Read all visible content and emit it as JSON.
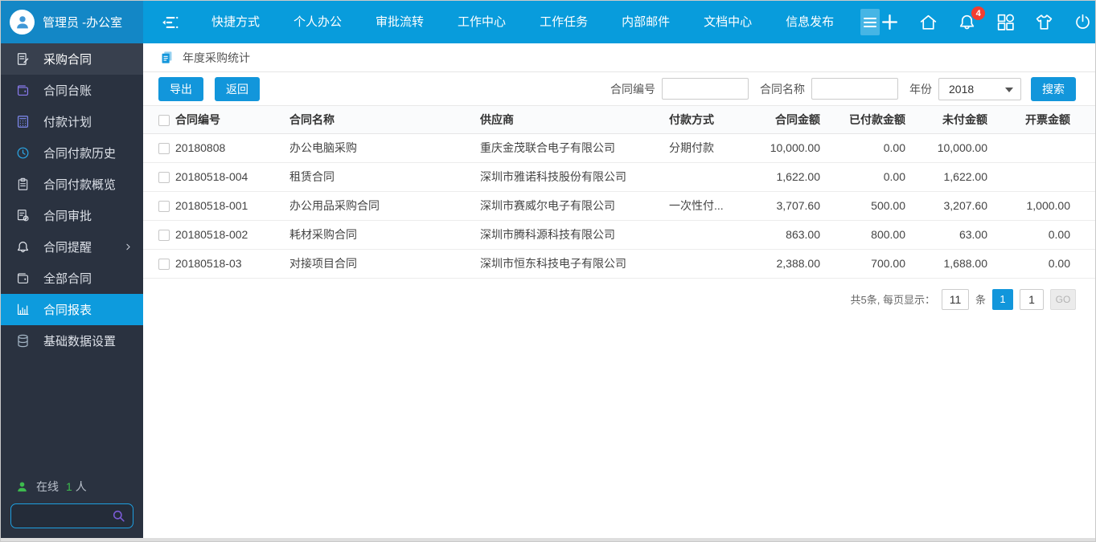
{
  "header": {
    "user": "管理员 -办公室",
    "menu": [
      "快捷方式",
      "个人办公",
      "审批流转",
      "工作中心",
      "工作任务",
      "内部邮件",
      "文档中心",
      "信息发布"
    ],
    "badge_count": "4",
    "icons": [
      {
        "name": "plus-icon"
      },
      {
        "name": "home-icon"
      },
      {
        "name": "bell-icon"
      },
      {
        "name": "apps-icon"
      },
      {
        "name": "shirt-icon"
      },
      {
        "name": "power-icon"
      }
    ],
    "colors": {
      "bar": "#089cdc",
      "user_block": "#1387c6",
      "badge": "#f23d30"
    }
  },
  "sidebar": {
    "items": [
      {
        "label": "采购合同",
        "icon": "contract-edit-icon",
        "icon_color": "#e2e6ec",
        "type": "head"
      },
      {
        "label": "合同台账",
        "icon": "wallet-icon",
        "icon_color": "#8b7bf0"
      },
      {
        "label": "付款计划",
        "icon": "calculator-icon",
        "icon_color": "#7f8af0"
      },
      {
        "label": "合同付款历史",
        "icon": "clock-icon",
        "icon_color": "#2aa8e8"
      },
      {
        "label": "合同付款概览",
        "icon": "clipboard-icon",
        "icon_color": "#cfd4dd"
      },
      {
        "label": "合同审批",
        "icon": "approve-icon",
        "icon_color": "#d9dde4"
      },
      {
        "label": "合同提醒",
        "icon": "bell-icon",
        "icon_color": "#dfe3ea",
        "chevron": true
      },
      {
        "label": "全部合同",
        "icon": "wallet-icon",
        "icon_color": "#d9dde4"
      },
      {
        "label": "合同报表",
        "icon": "chart-icon",
        "icon_color": "#ffffff",
        "active": true
      },
      {
        "label": "基础数据设置",
        "icon": "database-icon",
        "icon_color": "#a4b6c6"
      }
    ],
    "online": {
      "label": "在线",
      "count": "1",
      "unit": "人"
    },
    "colors": {
      "bg": "#2a3240",
      "active": "#0d9bdd",
      "online_green": "#3dbb4e"
    }
  },
  "breadcrumb": {
    "title": "年度采购统计"
  },
  "toolbar": {
    "export_label": "导出",
    "back_label": "返回",
    "filter_contract_no_label": "合同编号",
    "filter_contract_no_value": "",
    "filter_contract_name_label": "合同名称",
    "filter_contract_name_value": "",
    "year_label": "年份",
    "year_value": "2018",
    "search_label": "搜索",
    "button_color": "#1296db"
  },
  "table": {
    "headers": [
      "合同编号",
      "合同名称",
      "供应商",
      "付款方式",
      "合同金额",
      "已付款金额",
      "未付金额",
      "开票金额"
    ],
    "rows": [
      [
        "20180808",
        "办公电脑采购",
        "重庆金茂联合电子有限公司",
        "分期付款",
        "10,000.00",
        "0.00",
        "10,000.00",
        ""
      ],
      [
        "20180518-004",
        "租赁合同",
        "深圳市雅诺科技股份有限公司",
        "",
        "1,622.00",
        "0.00",
        "1,622.00",
        ""
      ],
      [
        "20180518-001",
        "办公用品采购合同",
        "深圳市赛威尔电子有限公司",
        "一次性付...",
        "3,707.60",
        "500.00",
        "3,207.60",
        "1,000.00"
      ],
      [
        "20180518-002",
        "耗材采购合同",
        "深圳市腾科源科技有限公司",
        "",
        "863.00",
        "800.00",
        "63.00",
        "0.00"
      ],
      [
        "20180518-03",
        "对接项目合同",
        "深圳市恒东科技电子有限公司",
        "",
        "2,388.00",
        "700.00",
        "1,688.00",
        "0.00"
      ]
    ]
  },
  "pagination": {
    "summary": "共5条, 每页显示：",
    "page_size": "11",
    "unit": "条",
    "current_page": "1",
    "goto_value": "1",
    "go_label": "GO"
  }
}
